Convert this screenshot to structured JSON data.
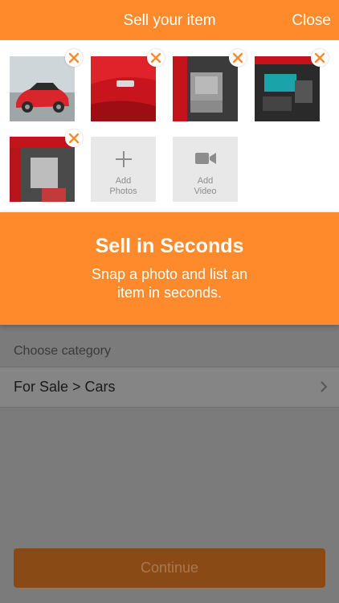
{
  "header": {
    "title": "Sell your item",
    "close_label": "Close"
  },
  "photos": {
    "items": [
      {
        "name": "photo-car-exterior"
      },
      {
        "name": "photo-car-badge"
      },
      {
        "name": "photo-car-seats"
      },
      {
        "name": "photo-engine"
      },
      {
        "name": "photo-interior"
      }
    ],
    "remove_icon": "close-x-icon",
    "add_photos_label_1": "Add",
    "add_photos_label_2": "Photos",
    "add_video_label_1": "Add",
    "add_video_label_2": "Video"
  },
  "banner": {
    "heading": "Sell in Seconds",
    "subtitle": "Snap a photo and list an item in seconds."
  },
  "category": {
    "label": "Choose category",
    "value": "For Sale > Cars"
  },
  "footer": {
    "continue_label": "Continue"
  },
  "colors": {
    "accent": "#ff8a2b",
    "overlay": "#7b7b7b"
  }
}
